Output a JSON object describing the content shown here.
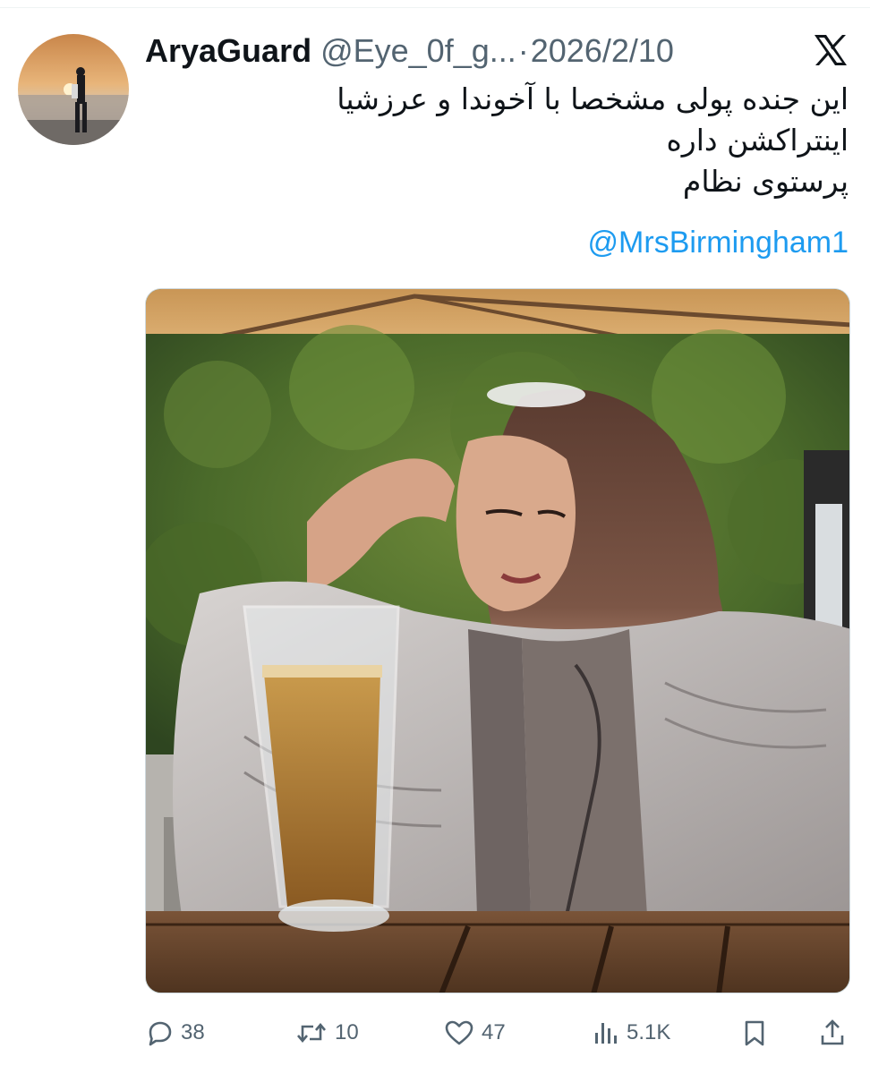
{
  "tweet": {
    "display_name": "AryaGuard",
    "handle": "@Eye_0f_g...",
    "separator": "·",
    "date": "2026/2/10",
    "text_lines": [
      "این جنده پولی مشخصا با آخوندا و عرزشیا",
      "اینتراکشن داره",
      "پرستوی نظام"
    ],
    "mention": "@MrsBirmingham1"
  },
  "actions": {
    "replies": "38",
    "retweets": "10",
    "likes": "47",
    "views": "5.1K"
  },
  "icons": {
    "platform": "x-logo-icon",
    "reply": "reply-icon",
    "retweet": "retweet-icon",
    "like": "heart-icon",
    "views": "views-icon",
    "bookmark": "bookmark-icon",
    "share": "share-icon"
  },
  "colors": {
    "text": "#0f1419",
    "secondary": "#536471",
    "link": "#1d9bf0"
  }
}
